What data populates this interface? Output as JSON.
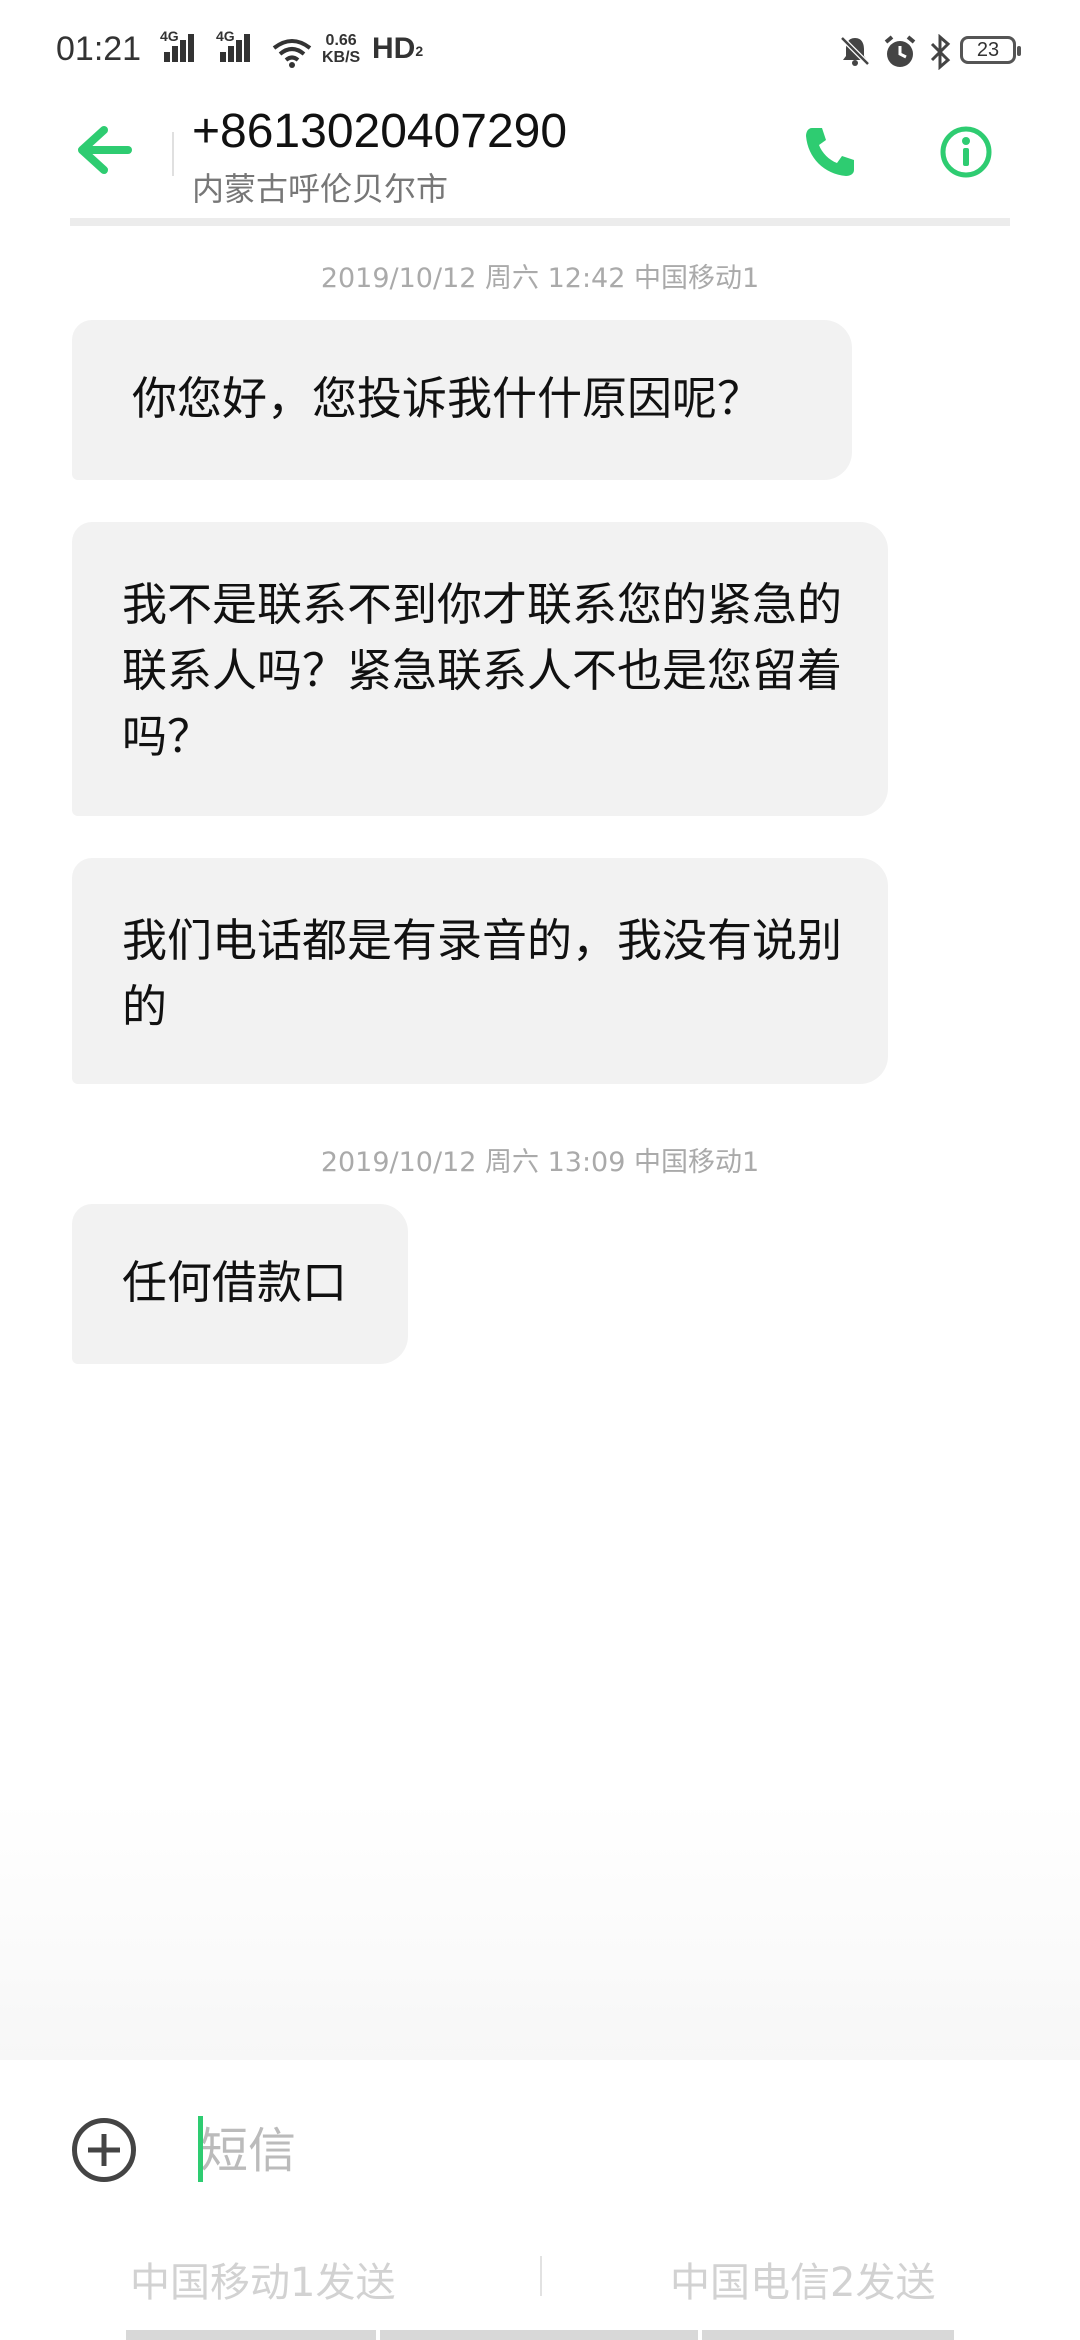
{
  "status_bar": {
    "time": "01:21",
    "network1": "4G",
    "network2": "4G",
    "speed_top": "0.66",
    "speed_bottom": "KB/S",
    "hd": "HD",
    "hd_sub": "2",
    "battery": "23"
  },
  "header": {
    "number": "+8613020407290",
    "location": "内蒙古呼伦贝尔市",
    "accent": "#2ecc71"
  },
  "messages": [
    {
      "timestamp": "2019/10/12 周六 12:42  中国移动1"
    },
    {
      "text": "你您好，您投诉我什什原因呢？"
    },
    {
      "text": "我不是联系不到你才联系您的紧急的联系人吗？紧急联系人不也是您留着吗？"
    },
    {
      "text": "我们电话都是有录音的，我没有说别的"
    },
    {
      "timestamp": "2019/10/12 周六 13:09  中国移动1"
    },
    {
      "text": "任何借款口"
    }
  ],
  "composer": {
    "placeholder": "短信",
    "send_sim1": "中国移动1发送",
    "send_sim2": "中国电信2发送"
  }
}
